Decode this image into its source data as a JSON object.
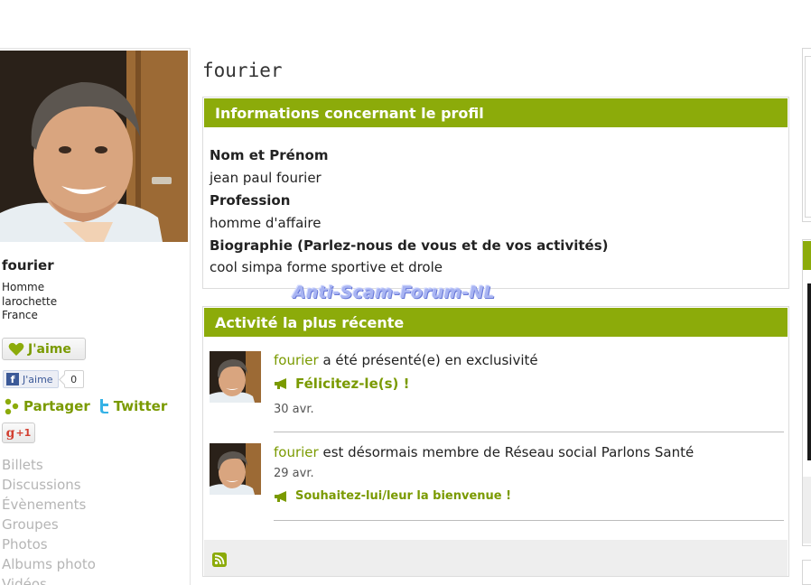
{
  "profile": {
    "name": "fourier",
    "gender": "Homme",
    "city": "larochette",
    "country": "France"
  },
  "social": {
    "like_label": "J'aime",
    "fb_like_label": "J'aime",
    "fb_count": "0",
    "share_label": "Partager",
    "twitter_label": "Twitter",
    "gplus_label": "+1"
  },
  "nav": {
    "items": [
      "Billets",
      "Discussions",
      "Évènements",
      "Groupes",
      "Photos",
      "Albums photo",
      "Vidéos"
    ]
  },
  "page_title": "fourier",
  "info_box": {
    "title": "Informations concernant le profil",
    "fields": [
      {
        "label": "Nom et Prénom",
        "value": "jean paul fourier"
      },
      {
        "label": "Profession",
        "value": "homme d'affaire"
      },
      {
        "label": "Biographie (Parlez-nous de vous et de vos activités)",
        "value": "cool simpa forme sportive et drole"
      }
    ]
  },
  "watermark": "Anti-Scam-Forum-NL",
  "activity_box": {
    "title": "Activité la plus récente",
    "items": [
      {
        "user": "fourier",
        "text": " a été présenté(e) en exclusivité",
        "action": "Félicitez-le(s) !",
        "date": "30 avr."
      },
      {
        "user": "fourier",
        "text": " est désormais membre de Réseau social Parlons Santé",
        "date": "29 avr.",
        "action": "Souhaitez-lui/leur la bienvenue !"
      }
    ]
  },
  "colors": {
    "accent": "#8cab0a",
    "link": "#7a9a00",
    "muted": "#b5b5b5"
  },
  "icons": [
    "heart-icon",
    "facebook-icon",
    "share-icon",
    "twitter-icon",
    "google-plus-icon",
    "megaphone-icon",
    "rss-icon"
  ]
}
